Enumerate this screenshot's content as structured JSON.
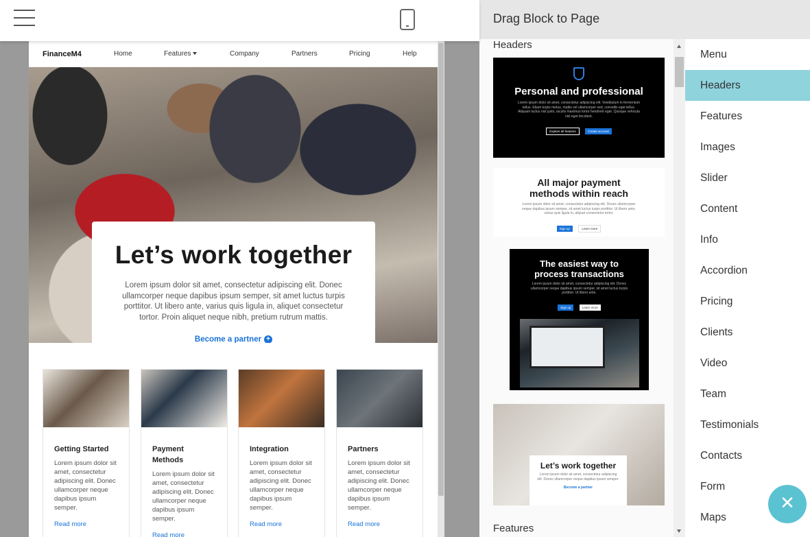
{
  "topbar": {
    "menu_icon": "hamburger-menu-icon",
    "device_icon": "mobile-phone-icon"
  },
  "site": {
    "brand": "FinanceM4",
    "nav": [
      "Home",
      "Features",
      "Company",
      "Partners",
      "Pricing",
      "Help"
    ],
    "hero": {
      "title": "Let’s work together",
      "text": "Lorem ipsum dolor sit amet, consectetur adipiscing elit. Donec ullamcorper neque dapibus ipsum semper, sit amet luctus turpis porttitor. Ut libero ante, varius quis ligula in, aliquet consectetur tortor. Proin aliquet neque nibh, pretium rutrum mattis.",
      "link": "Become a partner"
    },
    "cards": [
      {
        "title": "Getting Started",
        "text": "Lorem ipsum dolor sit amet, consectetur adipiscing elit. Donec ullamcorper neque dapibus ipsum semper.",
        "link": "Read more"
      },
      {
        "title": "Payment Methods",
        "text": "Lorem ipsum dolor sit amet, consectetur adipiscing elit. Donec ullamcorper neque dapibus ipsum semper.",
        "link": "Read more"
      },
      {
        "title": "Integration",
        "text": "Lorem ipsum dolor sit amet, consectetur adipiscing elit. Donec ullamcorper neque dapibus ipsum semper.",
        "link": "Read more"
      },
      {
        "title": "Partners",
        "text": "Lorem ipsum dolor sit amet, consectetur adipiscing elit. Donec ullamcorper neque dapibus ipsum semper.",
        "link": "Read more"
      }
    ]
  },
  "panel": {
    "title": "Drag Block to Page",
    "section_headers": "Headers",
    "section_features": "Features",
    "thumbs": [
      {
        "title": "Personal and professional",
        "text": "Lorem ipsum dolor sit amet, consectetur adipiscing elit. Vestibulum in fermentum tellus. Etiam turpis metus, mattis vel ullamcorper sed, convallis eget tellus. Aliquam luctus nisl justo, iaculis maximus tortor hendrerit eget. Quisque vehicula nisl eget tincidunt.",
        "btn1": "Explore all features",
        "btn2": "Create account"
      },
      {
        "title": "All major payment methods within reach",
        "text": "Lorem ipsum dolor sit amet, consectetur adipiscing elit. Donec ullamcorper neque dapibus ipsum semper, sit amet luctus turpis porttitor. Ut libero ante, varius quis ligula in, aliquet consectetur tortor.",
        "btn1": "Sign up",
        "btn2": "Learn more"
      },
      {
        "title": "The easiest way to process transactions",
        "text": "Lorem ipsum dolor sit amet, consectetur adipiscing elit. Donec ullamcorper neque dapibus ipsum semper, sit amet luctus turpis porttitor. Ut libero ante.",
        "btn1": "Sign up",
        "btn2": "Learn more"
      },
      {
        "title": "Let’s work together",
        "text": "Lorem ipsum dolor sit amet, consectetur adipiscing elit. Donec ullamcorper neque dapibus ipsum semper.",
        "link": "Become a partner"
      }
    ],
    "categories": [
      "Menu",
      "Headers",
      "Features",
      "Images",
      "Slider",
      "Content",
      "Info",
      "Accordion",
      "Pricing",
      "Clients",
      "Video",
      "Team",
      "Testimonials",
      "Contacts",
      "Form",
      "Maps"
    ],
    "active_category": "Headers"
  },
  "colors": {
    "accent": "#1a73d9",
    "active_category_bg": "#8fd3dd",
    "fab": "#5bc2d2"
  }
}
